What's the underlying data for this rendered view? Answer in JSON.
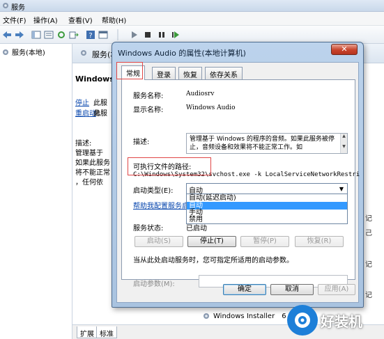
{
  "window": {
    "title": "服务"
  },
  "menu": [
    "文件(F)",
    "操作(A)",
    "查看(V)",
    "帮助(H)"
  ],
  "toolbar": [
    "back-arrow-icon",
    "forward-arrow-icon",
    "console-tree-icon",
    "properties-icon",
    "refresh-icon",
    "export-icon",
    "help-icon",
    "console-icon",
    "play-icon",
    "stop-icon",
    "pause-icon",
    "restart-icon"
  ],
  "tree": {
    "root": "服务(本地)"
  },
  "right_pane": {
    "header": "服务(本地)",
    "service_name": "Windows",
    "link_stop": "停止",
    "link_stop_suffix": "此服务",
    "link_restart": "重启动",
    "link_restart_suffix": "此服",
    "desc_label": "描述:",
    "desc_lines": [
      "管理基于",
      "如果此服务",
      "将不能正常",
      "，任何依"
    ],
    "list_bits": [
      "记",
      "己",
      "记",
      "记"
    ],
    "installer_row": "Windows Installer",
    "installer_tail": "6"
  },
  "bottom_tabs": [
    "扩展",
    "标准"
  ],
  "dialog": {
    "title": "Windows Audio 的属性(本地计算机)",
    "close": "✕",
    "tabs": [
      "常规",
      "登录",
      "恢复",
      "依存关系"
    ],
    "service_name_label": "服务名称:",
    "service_name_value": "Audiosrv",
    "display_name_label": "显示名称:",
    "display_name_value": "Windows Audio",
    "description_label": "描述:",
    "description_value": "管理基于 Windows 的程序的音频。如果此服务被停止，音频设备和效果将不能正常工作。如",
    "exe_path_label": "可执行文件的路径:",
    "exe_path_value": "C:\\Windows\\System32\\svchost.exe -k LocalServiceNetworkRestri",
    "startup_type_label": "启动类型(E):",
    "startup_type_value": "自动",
    "startup_options": [
      "自动(延迟启动)",
      "自动",
      "手动",
      "禁用"
    ],
    "startup_highlight": "自动",
    "help_link": "帮助我配置服务启动",
    "status_label": "服务状态:",
    "status_value": "已启动",
    "buttons": {
      "start": "启动(S)",
      "stop": "停止(T)",
      "pause": "暂停(P)",
      "resume": "恢复(R)"
    },
    "hint": "当从此处启动服务时，您可指定所适用的启动参数。",
    "params_label": "启动参数(M):",
    "params_value": "",
    "ok": "确定",
    "cancel": "取消",
    "apply": "应用(A)"
  },
  "watermark": {
    "text": "好装机"
  },
  "colors": {
    "highlight": "#3399ff",
    "annotation_red": "#e04646",
    "close_red": "#c8432b"
  }
}
